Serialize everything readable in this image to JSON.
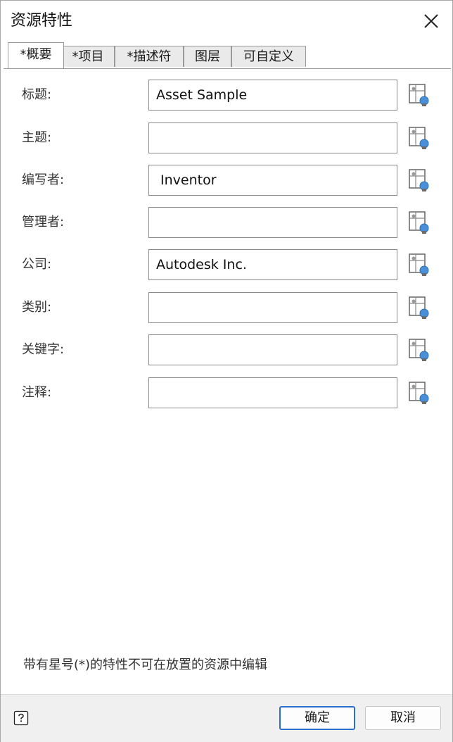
{
  "dialog": {
    "title": "资源特性"
  },
  "tabs": [
    {
      "label": "*概要",
      "active": true
    },
    {
      "label": "*项目"
    },
    {
      "label": "*描述符"
    },
    {
      "label": "图层"
    },
    {
      "label": "可自定义"
    }
  ],
  "fields": [
    {
      "label": "标题:",
      "value": "Asset Sample"
    },
    {
      "label": "主题:",
      "value": ""
    },
    {
      "label": "编写者:",
      "value": " Inventor"
    },
    {
      "label": "管理者:",
      "value": ""
    },
    {
      "label": "公司:",
      "value": "Autodesk Inc."
    },
    {
      "label": "类别:",
      "value": ""
    },
    {
      "label": "关键字:",
      "value": ""
    },
    {
      "label": "注释:",
      "value": ""
    }
  ],
  "note": "带有星号(*)的特性不可在放置的资源中编辑",
  "footer": {
    "ok_label": "确定",
    "cancel_label": "取消"
  },
  "icons": {
    "close": "close-icon",
    "field_picker": "property-picker-icon",
    "help": "help-icon"
  },
  "colors": {
    "primary_border": "#2a6fcb",
    "pin_blue": "#4a90d9"
  }
}
